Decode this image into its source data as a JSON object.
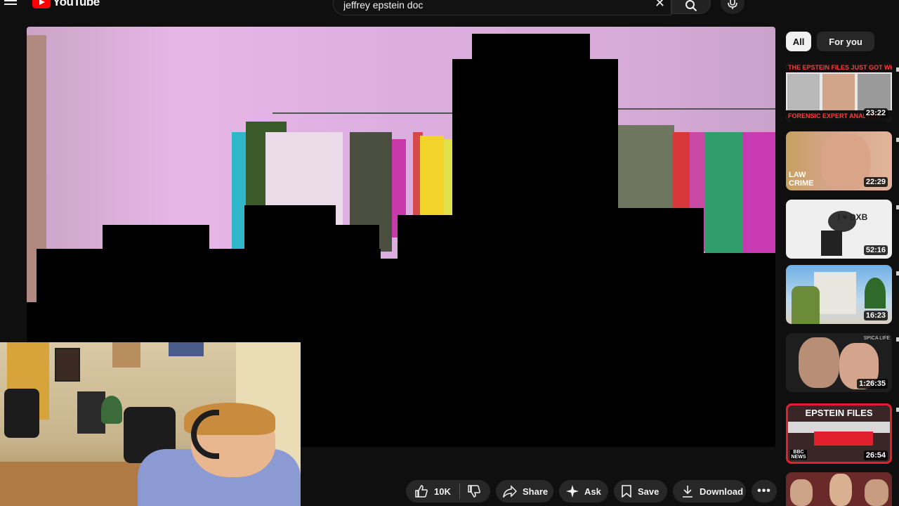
{
  "header": {
    "logo_text": "YouTube",
    "search_value": "jeffrey epstein doc",
    "icons": [
      "menu-icon",
      "clear-icon",
      "search-icon",
      "microphone-icon"
    ]
  },
  "actions": {
    "like_count": "10K",
    "share_label": "Share",
    "ask_label": "Ask",
    "save_label": "Save",
    "download_label": "Download"
  },
  "sidebar": {
    "chips": [
      "All",
      "For you"
    ],
    "thumbnails": [
      {
        "banner_top": "THE EPSTEIN FILES JUST GOT WEIRDER",
        "banner_bottom": "FORENSIC EXPERT ANALYSIS",
        "duration": "23:22"
      },
      {
        "overlay": "LAW CRIME",
        "duration": "22:29"
      },
      {
        "overlay": "I ♥ DXB",
        "duration": "52:16"
      },
      {
        "duration": "16:23"
      },
      {
        "overlay": "SPICA LIFE",
        "duration": "1:26:35"
      },
      {
        "banner_top": "EPSTEIN FILES",
        "overlay": "BBC NEWS",
        "duration": "26:54"
      }
    ]
  },
  "colors": {
    "background": "#0f0f0f",
    "pill": "#272727",
    "brand_red": "#ff0000",
    "chip_active": "#f1f1f1"
  }
}
